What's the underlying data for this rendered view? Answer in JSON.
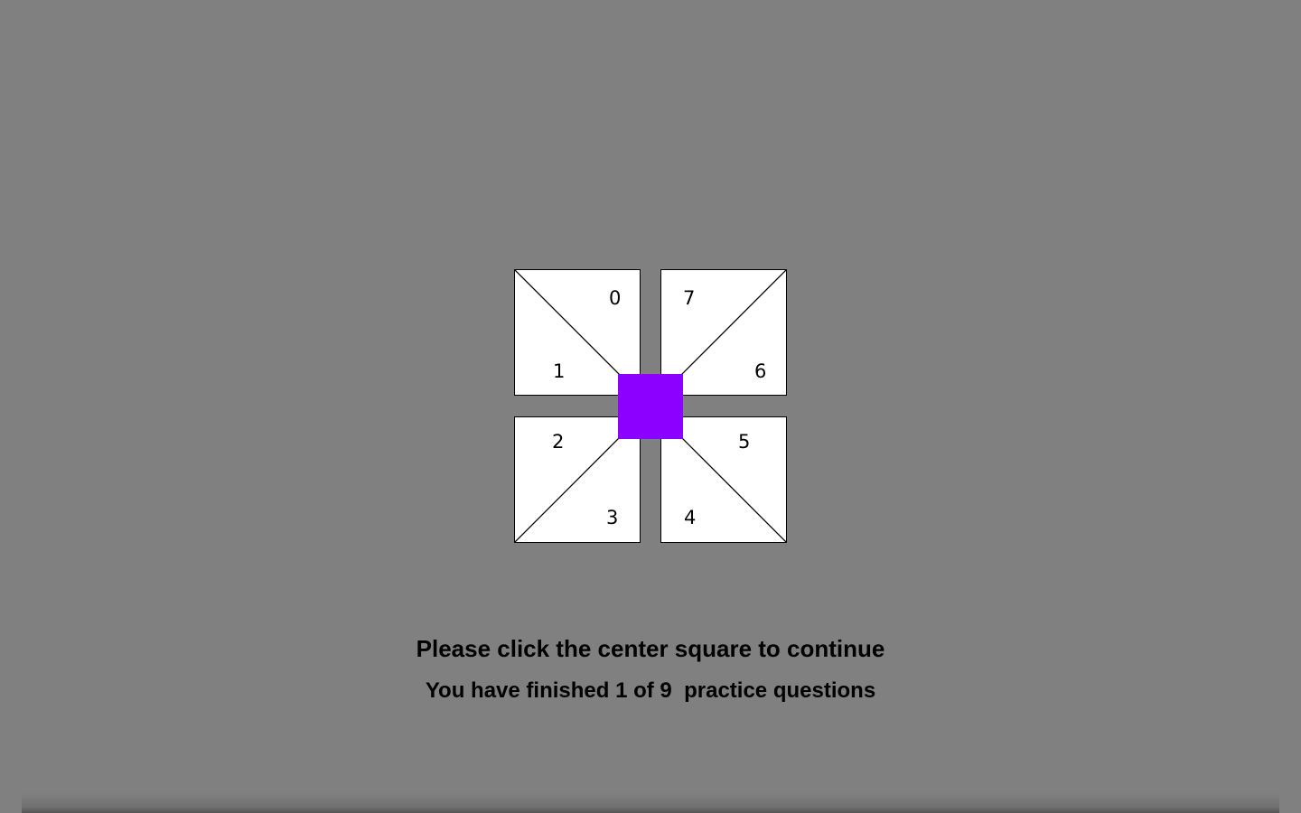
{
  "colors": {
    "background": "#808080",
    "center_square": "#8b00ff",
    "tile_fill": "#ffffff",
    "tile_stroke": "#000000"
  },
  "tiles": {
    "top_left": {
      "upper_label": "0",
      "lower_label": "1"
    },
    "top_right": {
      "upper_label": "7",
      "lower_label": "6"
    },
    "bottom_left": {
      "upper_label": "2",
      "lower_label": "3"
    },
    "bottom_right": {
      "upper_label": "5",
      "lower_label": "4"
    }
  },
  "messages": {
    "instruction": "Please click the center square to continue",
    "progress": "You have finished 1 of 9  practice questions"
  },
  "progress": {
    "finished": 1,
    "total": 9
  }
}
